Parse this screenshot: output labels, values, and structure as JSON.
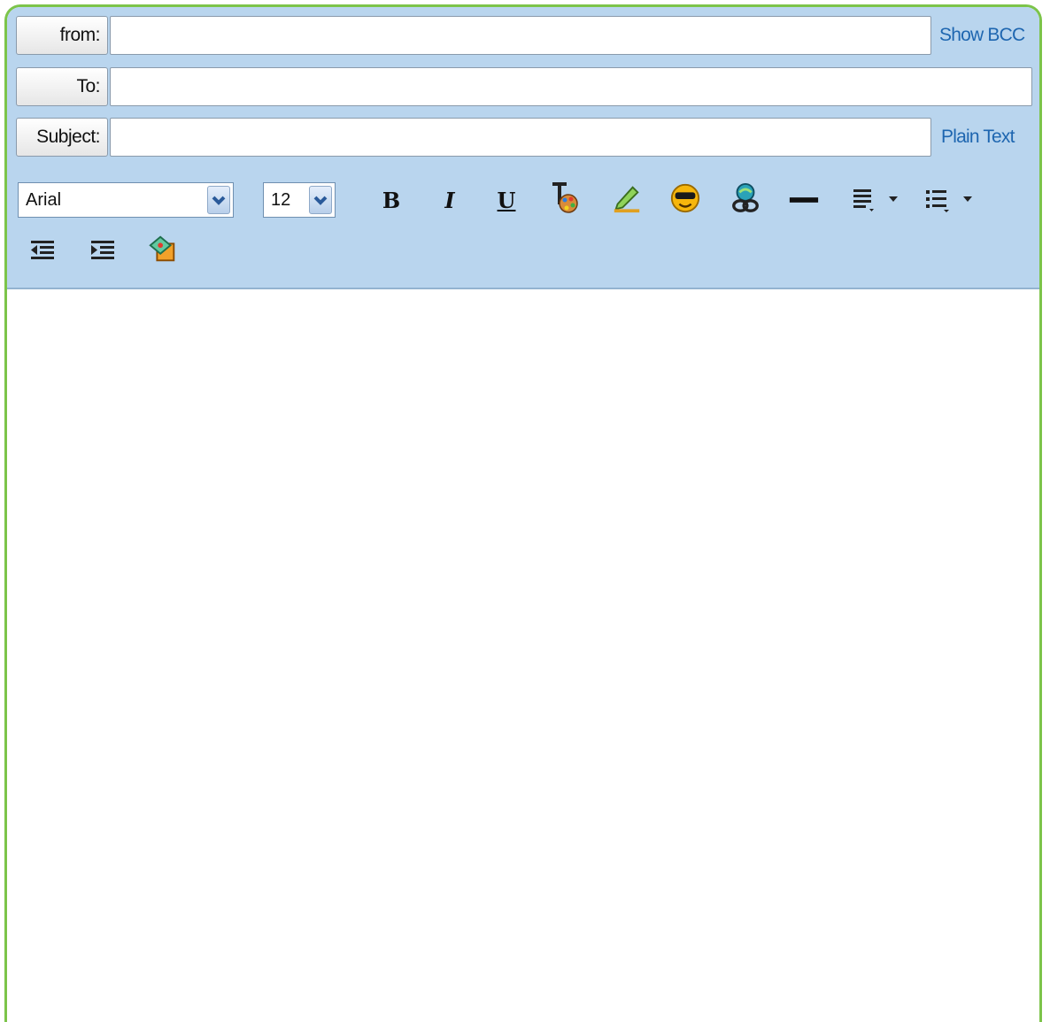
{
  "compose": {
    "from_label": "from:",
    "from_value": "",
    "to_label": "To:",
    "to_value": "",
    "subject_label": "Subject:",
    "subject_value": "",
    "show_bcc_label": "Show BCC",
    "plain_text_label": "Plain Text"
  },
  "toolbar": {
    "font_family": "Arial",
    "font_size": "12",
    "bold_label": "B",
    "italic_label": "I",
    "underline_label": "U",
    "icons": [
      "chevron-down-icon",
      "bold-icon",
      "italic-icon",
      "underline-icon",
      "text-color-icon",
      "highlight-icon",
      "emoticon-icon",
      "link-icon",
      "horizontal-rule-icon",
      "align-icon",
      "list-icon",
      "outdent-icon",
      "indent-icon",
      "stationery-icon"
    ]
  },
  "body": {
    "content": ""
  },
  "colors": {
    "header_bg": "#b9d5ee",
    "frame_border": "#7cc44a",
    "link": "#1e66b0"
  }
}
